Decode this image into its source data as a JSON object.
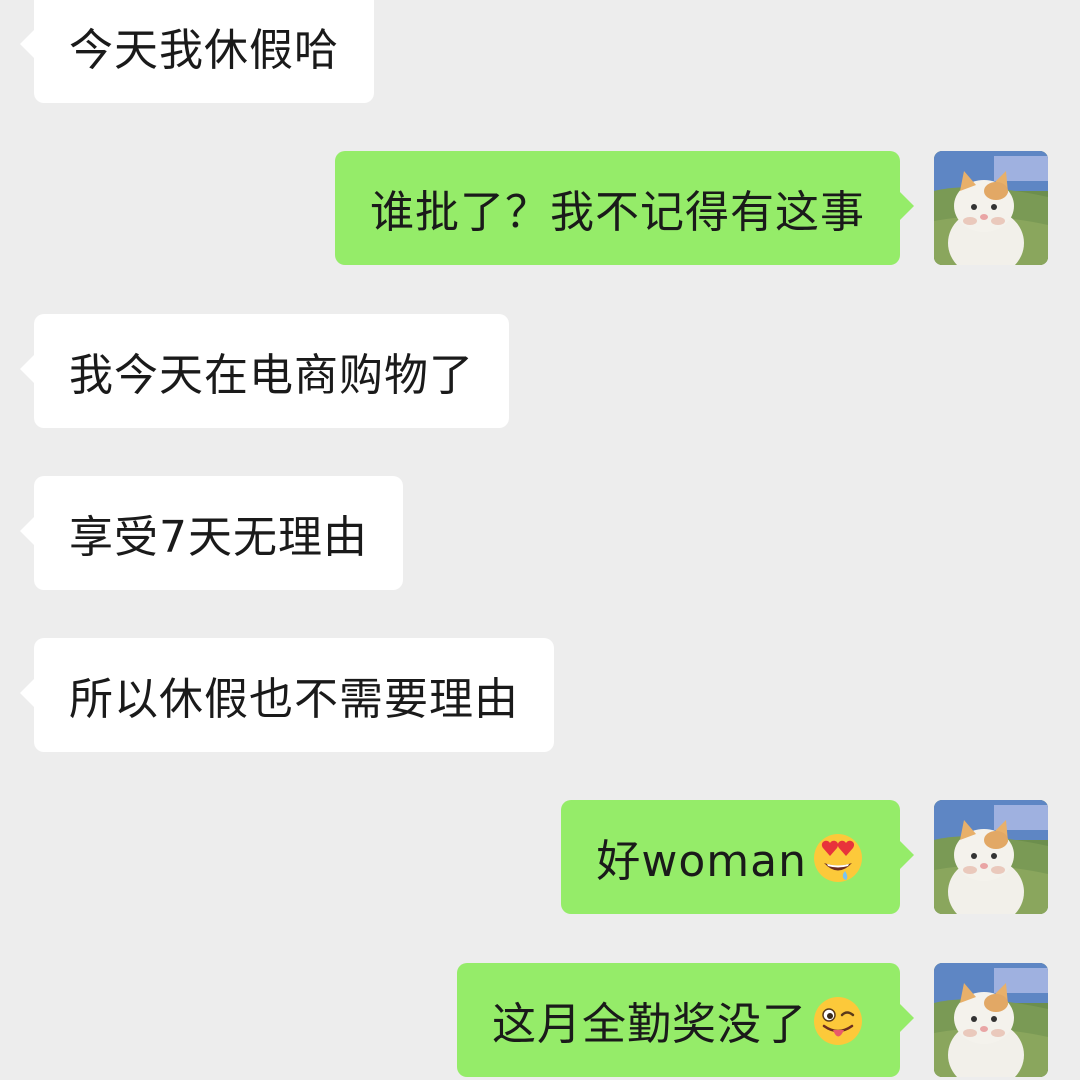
{
  "conversation": {
    "messages": [
      {
        "sender": "other",
        "text": "今天我休假哈"
      },
      {
        "sender": "self",
        "text": "谁批了？我不记得有这事"
      },
      {
        "sender": "other",
        "text": "我今天在电商购物了"
      },
      {
        "sender": "other",
        "text": "享受7天无理由"
      },
      {
        "sender": "other",
        "text": "所以休假也不需要理由"
      },
      {
        "sender": "self",
        "text": "好woman",
        "emoji": "heart-eyes-drooling-emoji"
      },
      {
        "sender": "self",
        "text": "这月全勤奖没了",
        "emoji": "winking-tongue-emoji"
      }
    ]
  },
  "theme": {
    "background": "#ededed",
    "incoming_bubble": "#ffffff",
    "outgoing_bubble": "#95ec69",
    "text_color": "#1a1a1a"
  },
  "avatar": {
    "icon": "cat-photo-avatar"
  }
}
